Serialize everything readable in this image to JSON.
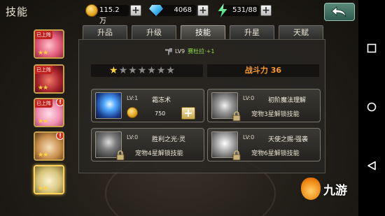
{
  "header": {
    "title": "技能"
  },
  "resources": {
    "gold": "115.2万",
    "gems": "4068",
    "stamina": "531/88"
  },
  "portraits": [
    {
      "tag": "已上阵",
      "stars": "★★",
      "alert": ""
    },
    {
      "tag": "已上阵",
      "stars": "★★",
      "alert": ""
    },
    {
      "tag": "已上阵",
      "stars": "★★",
      "alert": "!"
    },
    {
      "tag": "",
      "stars": "★★",
      "alert": "!"
    },
    {
      "tag": "",
      "stars": "★★",
      "alert": ""
    }
  ],
  "tabs": [
    "升品",
    "升级",
    "技能",
    "升星",
    "天赋"
  ],
  "active_tab": "技能",
  "pet": {
    "level": "LV9",
    "name": "赛杜拉·+1"
  },
  "rating": {
    "stars_on": 1,
    "stars_total": 7
  },
  "power": {
    "label": "战斗力",
    "value": "36"
  },
  "skills": [
    {
      "level": "LV:1",
      "name": "霜冻术",
      "cost": "750",
      "requirement": ""
    },
    {
      "level": "LV:0",
      "name": "初阶魔法理解",
      "cost": "",
      "requirement": "宠物3星解锁技能"
    },
    {
      "level": "LV:0",
      "name": "胜利之光·灵",
      "cost": "",
      "requirement": "宠物4星解锁技能"
    },
    {
      "level": "LV:0",
      "name": "天使之赐·强袭",
      "cost": "",
      "requirement": "宠物6星解锁技能"
    }
  ],
  "watermark": {
    "text": "九游"
  },
  "colors": {
    "accent": "#ff9a2a",
    "gold": "#ffd23a",
    "pet_name": "#8fe04a"
  }
}
